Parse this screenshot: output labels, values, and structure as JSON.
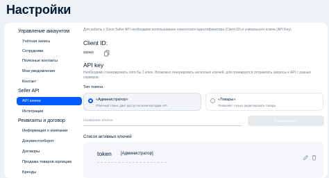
{
  "page": {
    "title": "Настройки"
  },
  "sidebar": {
    "sections": [
      {
        "title": "Управление аккаунтом",
        "items": [
          {
            "label": "Учётная запись"
          },
          {
            "label": "Сотрудники"
          },
          {
            "label": "Полезные контакты"
          },
          {
            "label": "Мои уведомления"
          },
          {
            "label": "Контакт"
          }
        ]
      },
      {
        "title": "Seller API",
        "items": [
          {
            "label": "API ключи",
            "active": true
          },
          {
            "label": "Интеграции"
          }
        ]
      },
      {
        "title": "Реквизиты и договор",
        "items": [
          {
            "label": "Информация о компании"
          },
          {
            "label": "Документооборот"
          },
          {
            "label": "Договоры"
          },
          {
            "label": "Продажа товаров юрлицам"
          },
          {
            "label": "Бренды"
          }
        ]
      }
    ]
  },
  "main": {
    "intro": "Для работы с Ozon Seller API необходимо использование клиентского идентификатора (Client ID) и уникального ключа (API Key).",
    "client_id": {
      "label": "Client ID:",
      "value": "xxxxxx"
    },
    "api_key": {
      "title": "API key",
      "description": "Необходимо сгенерировать хотя бы 1 ключ. Возможно генерировать несколько ключей, для планируется отправлять запросы к API с разных серверов."
    },
    "token_type": {
      "label": "Тип токена",
      "options": [
        {
          "title": "«Администратор»",
          "desc": "Обычный токен, дает доступ ко всем методам API",
          "selected": true
        },
        {
          "title": "«Товары»",
          "desc": "Позволяет только редактировать товары",
          "selected": false
        }
      ]
    },
    "name_input": {
      "placeholder": "Название ключа",
      "value": ""
    },
    "create_button": {
      "label": "Создать ключ"
    },
    "active_keys": {
      "label": "Список активных ключей",
      "items": [
        {
          "name": "token",
          "type": "[Администратор]"
        }
      ]
    }
  },
  "colors": {
    "accent": "#005bff",
    "background": "#eef1f5",
    "text": "#001a34",
    "muted": "#707f8d"
  }
}
